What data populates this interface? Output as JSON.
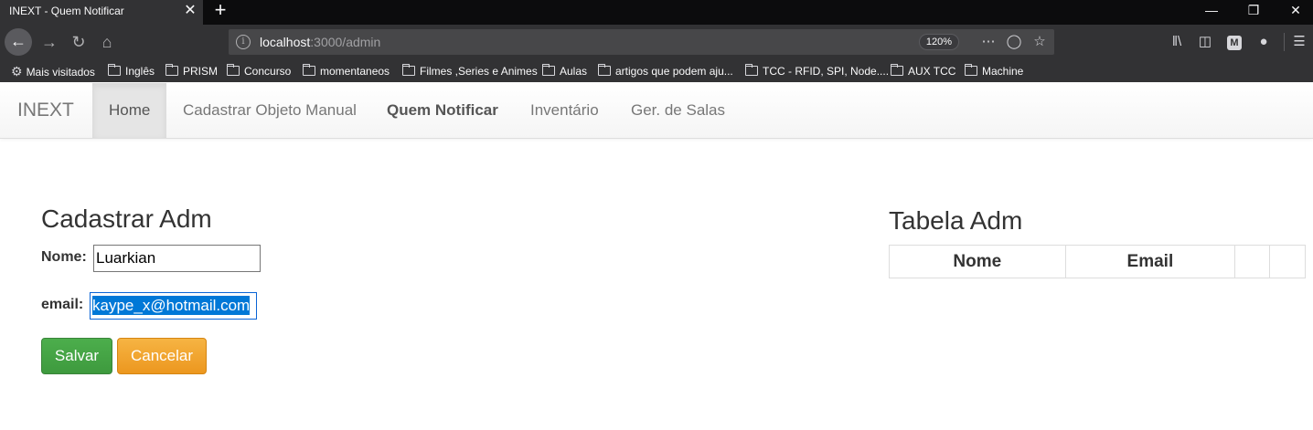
{
  "browser": {
    "tab_title": "INEXT - Quem Notificar",
    "tab_close": "✕",
    "new_tab": "+",
    "url_host": "localhost",
    "url_path": ":3000/admin",
    "zoom": "120%",
    "window_minimize": "—",
    "window_restore": "❐",
    "window_close": "✕"
  },
  "bookmarks": [
    {
      "label": "Mais visitados",
      "icon": "gear-icon"
    },
    {
      "label": "Inglês",
      "icon": "folder-icon"
    },
    {
      "label": "PRISM",
      "icon": "folder-icon"
    },
    {
      "label": "Concurso",
      "icon": "folder-icon"
    },
    {
      "label": "momentaneos",
      "icon": "folder-icon"
    },
    {
      "label": "Filmes ,Series e Animes",
      "icon": "folder-icon"
    },
    {
      "label": "Aulas",
      "icon": "folder-icon"
    },
    {
      "label": "artigos que podem aju...",
      "icon": "folder-icon"
    },
    {
      "label": "TCC - RFID, SPI, Node....",
      "icon": "folder-icon"
    },
    {
      "label": "AUX TCC",
      "icon": "folder-icon"
    },
    {
      "label": "Machine",
      "icon": "folder-icon"
    }
  ],
  "app_nav": {
    "brand": "INEXT",
    "items": [
      {
        "label": "Home",
        "active": true
      },
      {
        "label": "Cadastrar Objeto Manual"
      },
      {
        "label": "Quem Notificar",
        "bold": true
      },
      {
        "label": "Inventário"
      },
      {
        "label": "Ger. de Salas"
      }
    ]
  },
  "form": {
    "title": "Cadastrar Adm",
    "name_label": "Nome:",
    "name_value": "Luarkian",
    "email_label": "email:",
    "email_value": "kaype_x@hotmail.com",
    "save_label": "Salvar",
    "cancel_label": "Cancelar"
  },
  "table": {
    "title": "Tabela Adm",
    "columns": [
      "Nome",
      "Email",
      "",
      ""
    ]
  },
  "colors": {
    "success": "#449d44",
    "warning": "#f0ad4e",
    "selection": "#0078d7"
  }
}
